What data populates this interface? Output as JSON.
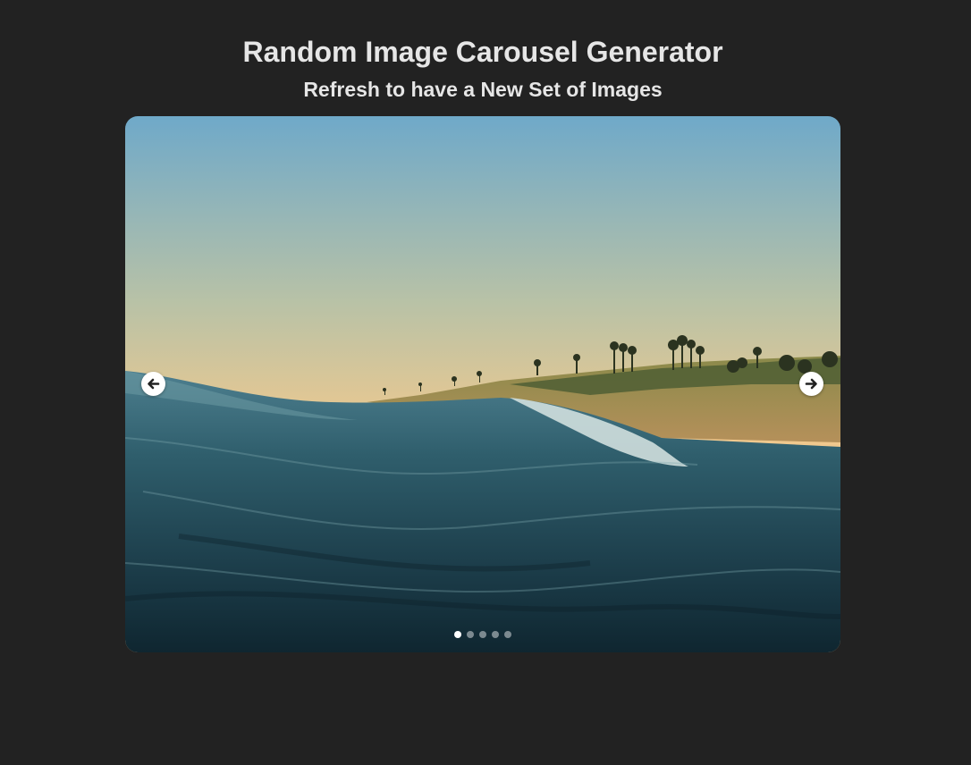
{
  "header": {
    "title": "Random Image Carousel Generator",
    "subtitle": "Refresh to have a New Set of Images"
  },
  "carousel": {
    "current_slide": 1,
    "slide_count": 5,
    "prev_icon": "arrow-left-icon",
    "next_icon": "arrow-right-icon",
    "slide_image": "ocean-wave-coastline-sunset"
  },
  "colors": {
    "background": "#222222",
    "heading_text": "#e6e6e6",
    "dot_active": "#ffffff"
  }
}
